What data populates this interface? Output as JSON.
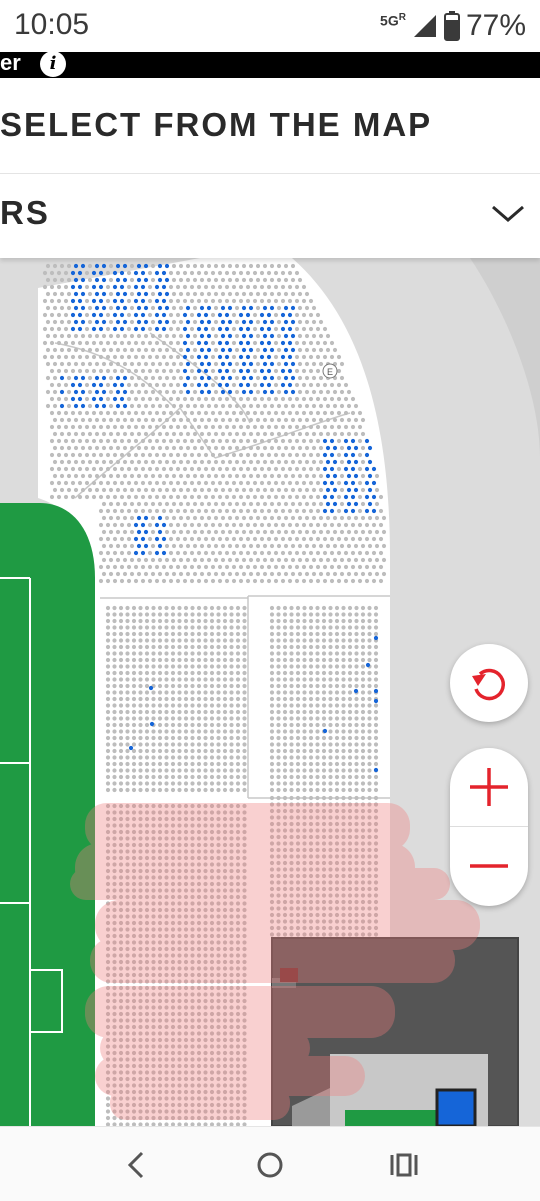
{
  "status_bar": {
    "time": "10:05",
    "network": "5G",
    "network_sup": "R",
    "battery_percent": "77%"
  },
  "banner": {
    "text": "er",
    "info_icon": "info-icon",
    "info_glyph": "i"
  },
  "header": {
    "title": "SELECT FROM THE MAP"
  },
  "section_selector": {
    "label": "RS",
    "icon": "chevron-down-icon"
  },
  "map_controls": {
    "reset": "reset-view-icon",
    "zoom_in": "plus-icon",
    "zoom_out": "minus-icon",
    "accent_color": "#e4232c"
  },
  "map": {
    "available_seat_color": "#1565d8",
    "unavailable_seat_color": "#bdbdbd",
    "pitch_color": "#1f9a43",
    "annotation_color": "#f28b8b",
    "entrance_marker": "E"
  },
  "nav_bar": {
    "back": "back-icon",
    "home": "home-icon",
    "recents": "recents-icon"
  }
}
